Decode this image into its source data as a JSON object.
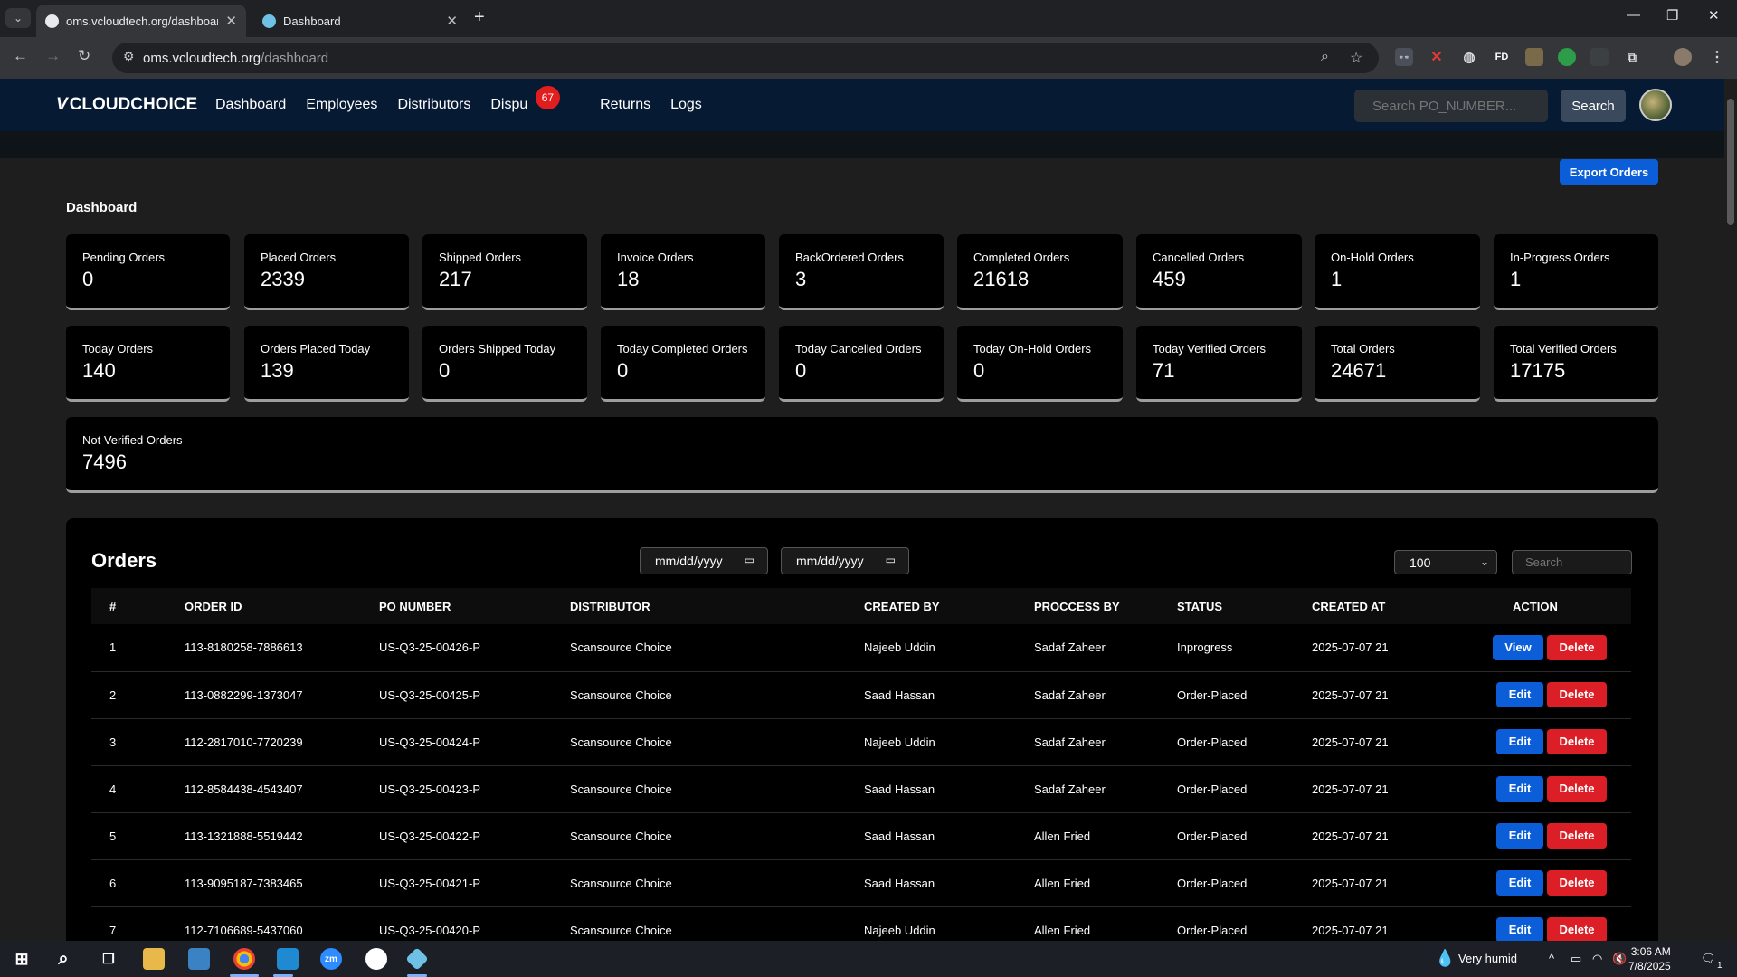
{
  "browser": {
    "tabs": [
      {
        "title": "oms.vcloudtech.org/dashboard",
        "active": true
      },
      {
        "title": "Dashboard",
        "active": false
      }
    ],
    "url_domain": "oms.vcloudtech.org",
    "url_path": "/dashboard"
  },
  "nav": {
    "logo": "CLOUDCHOICE",
    "links": [
      "Dashboard",
      "Employees",
      "Distributors",
      "Dispu",
      "Returns",
      "Logs"
    ],
    "disputes_badge": "67",
    "search_placeholder": "Search PO_NUMBER...",
    "search_button": "Search"
  },
  "export_button": "Export Orders",
  "dashboard_title": "Dashboard",
  "stats": [
    {
      "label": "Pending Orders",
      "value": "0"
    },
    {
      "label": "Placed Orders",
      "value": "2339"
    },
    {
      "label": "Shipped Orders",
      "value": "217"
    },
    {
      "label": "Invoice Orders",
      "value": "18"
    },
    {
      "label": "BackOrdered Orders",
      "value": "3"
    },
    {
      "label": "Completed Orders",
      "value": "21618"
    },
    {
      "label": "Cancelled Orders",
      "value": "459"
    },
    {
      "label": "On-Hold Orders",
      "value": "1"
    },
    {
      "label": "In-Progress Orders",
      "value": "1"
    },
    {
      "label": "Today Orders",
      "value": "140"
    },
    {
      "label": "Orders Placed Today",
      "value": "139"
    },
    {
      "label": "Orders Shipped Today",
      "value": "0"
    },
    {
      "label": "Today Completed Orders",
      "value": "0"
    },
    {
      "label": "Today Cancelled Orders",
      "value": "0"
    },
    {
      "label": "Today On-Hold Orders",
      "value": "0"
    },
    {
      "label": "Today Verified Orders",
      "value": "71"
    },
    {
      "label": "Total Orders",
      "value": "24671"
    },
    {
      "label": "Total Verified Orders",
      "value": "17175"
    },
    {
      "label": "Not Verified Orders",
      "value": "7496"
    }
  ],
  "orders": {
    "title": "Orders",
    "date_from_placeholder": "mm/dd/yyyy",
    "date_to_placeholder": "mm/dd/yyyy",
    "page_size": "100",
    "search_placeholder": "Search",
    "columns": [
      "#",
      "ORDER ID",
      "PO NUMBER",
      "DISTRIBUTOR",
      "CREATED BY",
      "PROCCESS BY",
      "STATUS",
      "CREATED AT",
      "ACTION"
    ],
    "rows": [
      {
        "n": "1",
        "order_id": "113-8180258-7886613",
        "po": "US-Q3-25-00426-P",
        "distributor": "Scansource Choice",
        "created_by": "Najeeb Uddin",
        "process_by": "Sadaf Zaheer",
        "status": "Inprogress",
        "created_at": "2025-07-07 21",
        "primary_action": "View",
        "delete_label": "Delete"
      },
      {
        "n": "2",
        "order_id": "113-0882299-1373047",
        "po": "US-Q3-25-00425-P",
        "distributor": "Scansource Choice",
        "created_by": "Saad Hassan",
        "process_by": "Sadaf Zaheer",
        "status": "Order-Placed",
        "created_at": "2025-07-07 21",
        "primary_action": "Edit",
        "delete_label": "Delete"
      },
      {
        "n": "3",
        "order_id": "112-2817010-7720239",
        "po": "US-Q3-25-00424-P",
        "distributor": "Scansource Choice",
        "created_by": "Najeeb Uddin",
        "process_by": "Sadaf Zaheer",
        "status": "Order-Placed",
        "created_at": "2025-07-07 21",
        "primary_action": "Edit",
        "delete_label": "Delete"
      },
      {
        "n": "4",
        "order_id": "112-8584438-4543407",
        "po": "US-Q3-25-00423-P",
        "distributor": "Scansource Choice",
        "created_by": "Saad Hassan",
        "process_by": "Sadaf Zaheer",
        "status": "Order-Placed",
        "created_at": "2025-07-07 21",
        "primary_action": "Edit",
        "delete_label": "Delete"
      },
      {
        "n": "5",
        "order_id": "113-1321888-5519442",
        "po": "US-Q3-25-00422-P",
        "distributor": "Scansource Choice",
        "created_by": "Saad Hassan",
        "process_by": "Allen Fried",
        "status": "Order-Placed",
        "created_at": "2025-07-07 21",
        "primary_action": "Edit",
        "delete_label": "Delete"
      },
      {
        "n": "6",
        "order_id": "113-9095187-7383465",
        "po": "US-Q3-25-00421-P",
        "distributor": "Scansource Choice",
        "created_by": "Saad Hassan",
        "process_by": "Allen Fried",
        "status": "Order-Placed",
        "created_at": "2025-07-07 21",
        "primary_action": "Edit",
        "delete_label": "Delete"
      },
      {
        "n": "7",
        "order_id": "112-7106689-5437060",
        "po": "US-Q3-25-00420-P",
        "distributor": "Scansource Choice",
        "created_by": "Najeeb Uddin",
        "process_by": "Allen Fried",
        "status": "Order-Placed",
        "created_at": "2025-07-07 21",
        "primary_action": "Edit",
        "delete_label": "Delete"
      }
    ]
  },
  "taskbar": {
    "weather": "Very humid",
    "time": "3:06 AM",
    "date": "7/8/2025",
    "notifications": "1"
  },
  "colors": {
    "nav_bg": "#071a33",
    "primary_blue": "#0b5ed7",
    "danger_red": "#dc1f26",
    "badge_red": "#e11d1d"
  }
}
